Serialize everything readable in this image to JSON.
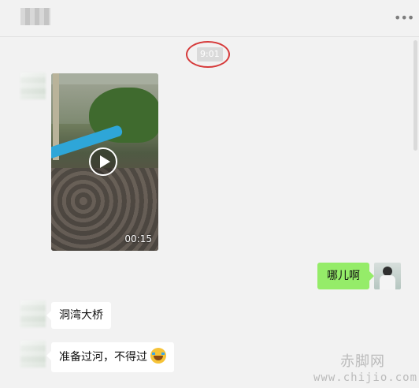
{
  "header": {
    "contact_name": "",
    "more_icon": "more-icon"
  },
  "timestamp": "9:01",
  "messages": [
    {
      "side": "left",
      "type": "video",
      "duration": "00:15",
      "icon": "play-icon"
    },
    {
      "side": "right",
      "type": "text",
      "text": "哪儿啊"
    },
    {
      "side": "left",
      "type": "text",
      "text": "洞湾大桥"
    },
    {
      "side": "left",
      "type": "text",
      "text": "准备过河，不得过",
      "emoji": "laugh-cry-emoji"
    }
  ],
  "colors": {
    "background": "#f2f2f2",
    "my_bubble": "#95ec69",
    "their_bubble": "#ffffff",
    "highlight_circle": "#d63a3a"
  },
  "watermark": {
    "site_name": "赤脚网",
    "url": "www.chijio.com"
  }
}
